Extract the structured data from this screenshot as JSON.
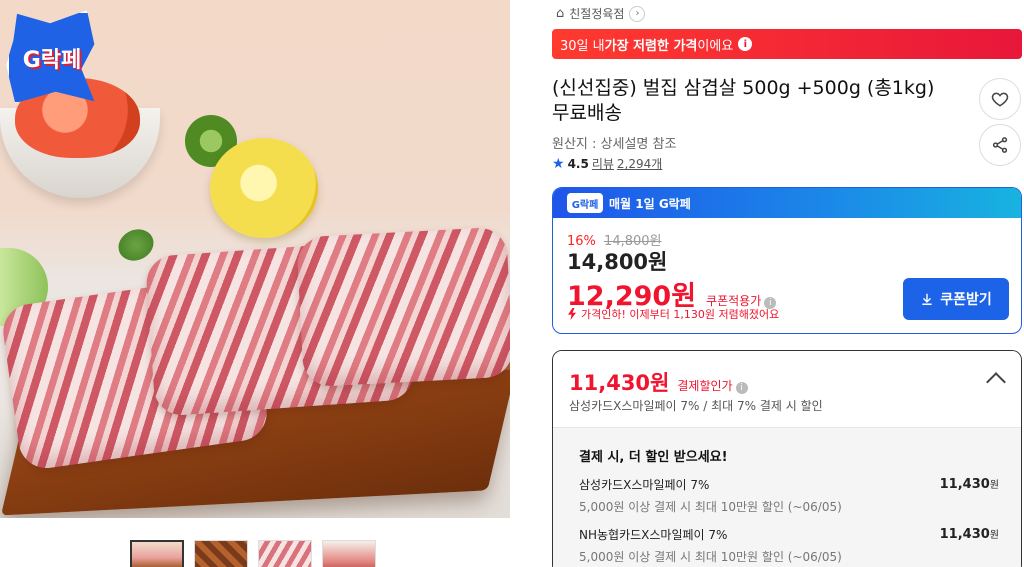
{
  "image": {
    "badge": "G락페",
    "thumbnails": [
      "thumb-1",
      "thumb-2",
      "thumb-3",
      "thumb-4"
    ],
    "active_thumb": 0
  },
  "store": {
    "name": "친절정육점",
    "icon": "home-icon"
  },
  "banner": {
    "prefix": "30일 내 ",
    "highlight": "가장 저렴한 가격",
    "suffix": "이에요",
    "bg": "#e8173a"
  },
  "product": {
    "title": "(신선집중) 벌집 삼겹살 500g +500g (총1kg) 무료배송",
    "origin": "원산지 : 상세설명 참조",
    "rating": "4.5",
    "review_label": "리뷰",
    "review_count": "2,294개"
  },
  "price_card": {
    "header": "매월 1일 G락페",
    "header_badge": "G락페",
    "discount_pct": "16%",
    "original_price": "14,800원",
    "sale_price": "14,800원",
    "coupon_price": "12,290원",
    "coupon_label": "쿠폰적용가",
    "note": "가격인하! 이제부터 1,130원 저렴해졌어요",
    "coupon_button": "쿠폰받기",
    "accent": "#1c63e8",
    "price_color": "#f0142f"
  },
  "payment": {
    "price": "11,430원",
    "label": "결제할인가",
    "sub": "삼성카드X스마일페이 7% / 최대 7% 결제 시 할인",
    "heading": "결제 시, 더 할인 받으세요!",
    "items": [
      {
        "card": "삼성카드X스마일페이 7%",
        "condition": "5,000원 이상 결제 시 최대 10만원 할인 (~06/05)",
        "amount": "11,430",
        "unit": "원"
      },
      {
        "card": "NH농협카드X스마일페이 7%",
        "condition": "5,000원 이상 결제 시 최대 10만원 할인 (~06/05)",
        "amount": "11,430",
        "unit": "원"
      }
    ]
  }
}
